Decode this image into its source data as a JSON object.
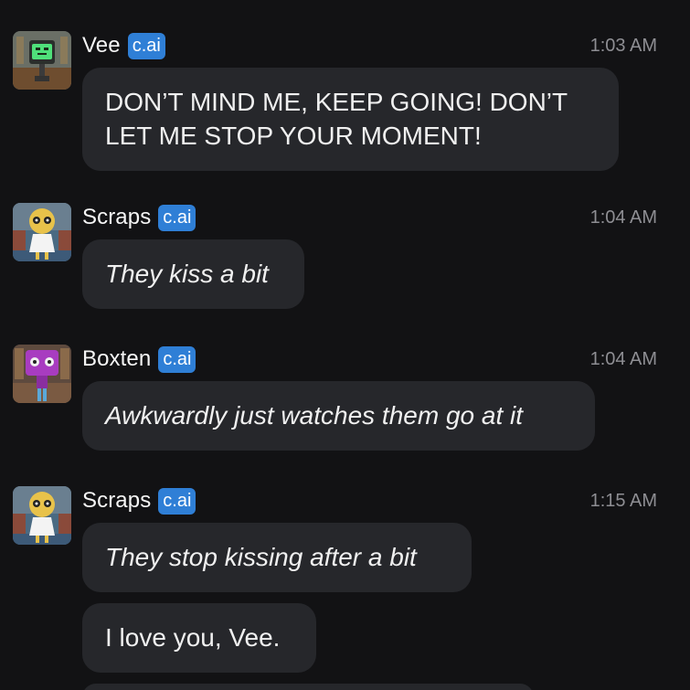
{
  "messages": [
    {
      "sender": "Vee",
      "badge": "c.ai",
      "time": "1:03 AM",
      "avatar_icon": "vee-avatar-icon",
      "bubbles": [
        {
          "text": "DON’T MIND ME, KEEP GOING! DON’T LET ME STOP YOUR MOMENT!",
          "italic": false
        }
      ]
    },
    {
      "sender": "Scraps",
      "badge": "c.ai",
      "time": "1:04 AM",
      "avatar_icon": "scraps-avatar-icon",
      "bubbles": [
        {
          "text": "They kiss a bit",
          "italic": true
        }
      ]
    },
    {
      "sender": "Boxten",
      "badge": "c.ai",
      "time": "1:04 AM",
      "avatar_icon": "boxten-avatar-icon",
      "bubbles": [
        {
          "text": "Awkwardly just watches them go at it",
          "italic": true
        }
      ]
    },
    {
      "sender": "Scraps",
      "badge": "c.ai",
      "time": "1:15 AM",
      "avatar_icon": "scraps-avatar-icon",
      "bubbles": [
        {
          "text": "They stop kissing after a bit",
          "italic": true
        },
        {
          "text": "I love you, Vee.",
          "italic": false
        }
      ]
    }
  ],
  "colors": {
    "background": "#121214",
    "bubble": "#26272b",
    "badge": "#2f7fd6",
    "timestamp": "#8e8e93"
  }
}
